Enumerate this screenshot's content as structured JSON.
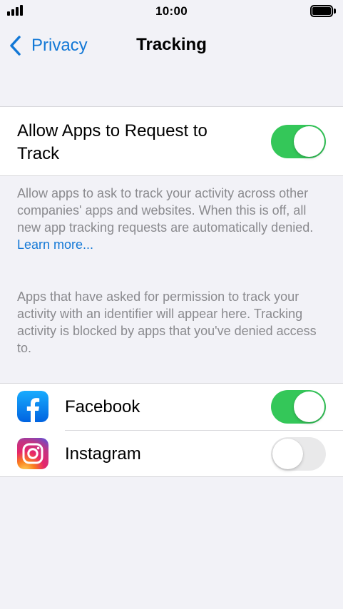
{
  "status_bar": {
    "time": "10:00",
    "signal_icon": "cellular-signal-icon",
    "battery_icon": "battery-full-icon"
  },
  "nav": {
    "back_label": "Privacy",
    "back_icon": "chevron-left-icon",
    "title": "Tracking"
  },
  "main_toggle": {
    "label": "Allow Apps to Request to Track",
    "state": "on"
  },
  "footer_1": {
    "text": "Allow apps to ask to track your activity across other companies' apps and websites. When this is off, all new app tracking requests are automatically denied. ",
    "link": "Learn more..."
  },
  "footer_2": {
    "text": "Apps that have asked for permission to track your activity with an identifier will appear here. Tracking activity is blocked by apps that you've denied access to."
  },
  "apps": [
    {
      "name": "Facebook",
      "icon": "facebook-icon",
      "state": "on"
    },
    {
      "name": "Instagram",
      "icon": "instagram-icon",
      "state": "off"
    }
  ],
  "colors": {
    "accent_blue": "#1378d6",
    "toggle_on": "#34c759",
    "toggle_off": "#e9e9ea",
    "background": "#f2f2f7",
    "secondary_text": "#8a8a8e"
  }
}
